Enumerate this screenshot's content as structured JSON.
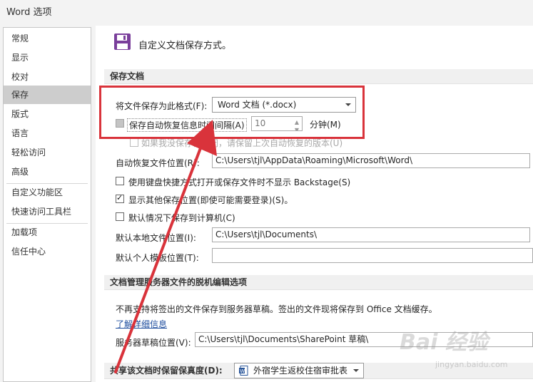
{
  "window": {
    "title": "Word 选项"
  },
  "sidebar": {
    "items": [
      {
        "label": "常规"
      },
      {
        "label": "显示"
      },
      {
        "label": "校对"
      },
      {
        "label": "保存"
      },
      {
        "label": "版式"
      },
      {
        "label": "语言"
      },
      {
        "label": "轻松访问"
      },
      {
        "label": "高级"
      },
      {
        "label": "自定义功能区"
      },
      {
        "label": "快速访问工具栏"
      },
      {
        "label": "加载项"
      },
      {
        "label": "信任中心"
      }
    ],
    "selected": "保存"
  },
  "header": {
    "title": "自定义文档保存方式。",
    "icon": "floppy-disk-icon"
  },
  "save_docs": {
    "section_title": "保存文档",
    "format_label": "将文件保存为此格式(F):",
    "format_value": "Word 文档 (*.docx)",
    "autorecover_label": "保存自动恢复信息时间间隔(A)",
    "autorecover_value": "10",
    "autorecover_unit": "分钟(M)",
    "keep_last_label": "如果我没保存就关闭，请保留上次自动恢复的版本(U)",
    "autorecover_path_label": "自动恢复文件位置(R):",
    "autorecover_path_value": "C:\\Users\\tjl\\AppData\\Roaming\\Microsoft\\Word\\",
    "no_backstage_label": "使用键盘快捷方式打开或保存文件时不显示 Backstage(S)",
    "show_more_label": "显示其他保存位置(即使可能需要登录)(S)。",
    "default_computer_label": "默认情况下保存到计算机(C)",
    "default_local_label": "默认本地文件位置(I):",
    "default_local_value": "C:\\Users\\tjl\\Documents\\",
    "template_label": "默认个人模板位置(T):",
    "template_value": ""
  },
  "offline": {
    "section_title": "文档管理服务器文件的脱机编辑选项",
    "info": "不再支持将签出的文件保存到服务器草稿。签出的文件现将保存到 Office 文档缓存。",
    "learn_more": "了解详细信息",
    "drafts_label": "服务器草稿位置(V):",
    "drafts_value": "C:\\Users\\tjl\\Documents\\SharePoint 草稿\\"
  },
  "fidelity": {
    "section_title": "共享该文档时保留保真度(D):",
    "doc_value": "外宿学生返校住宿审批表"
  },
  "watermark": {
    "main": "Bai 经验",
    "sub": "jingyan.baidu.com"
  },
  "colors": {
    "annotation_red": "#d9333b",
    "selected_item": "#cdcdcd"
  }
}
